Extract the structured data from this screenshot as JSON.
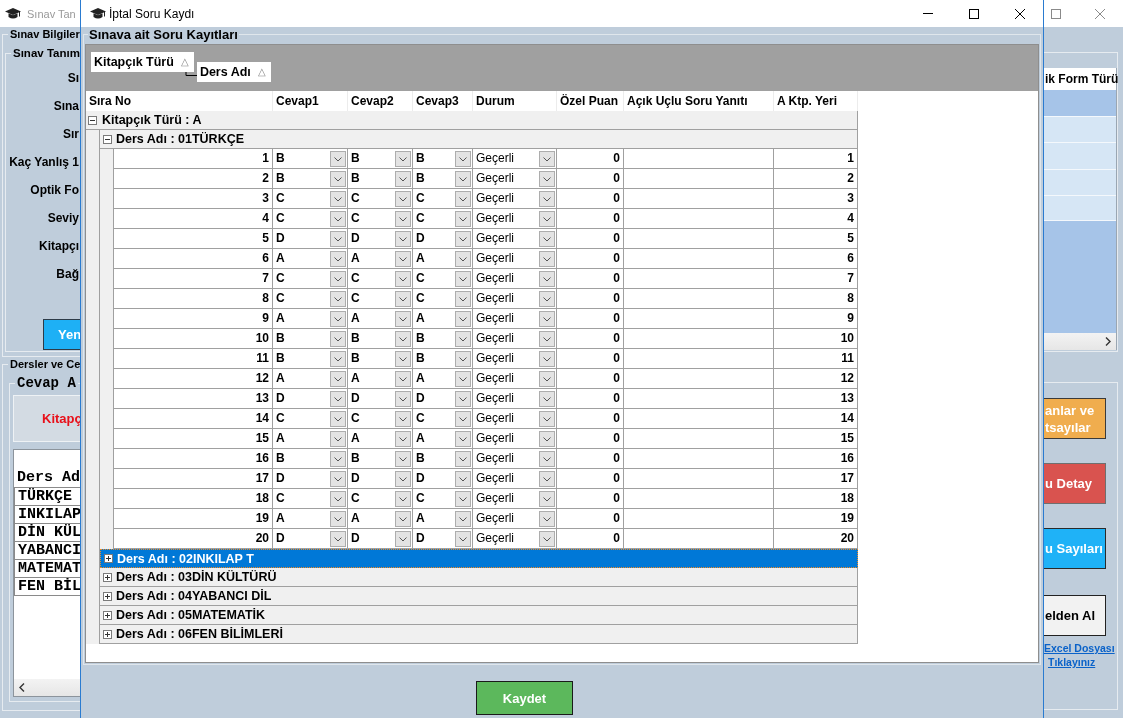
{
  "background_window": {
    "title": "Sınav Tan",
    "left_panel": {
      "info_group_title": "Sınav Bilgiler",
      "definition_group_title": "Sınav Tanım",
      "field_labels": [
        "Sı",
        "Sına",
        "Sır",
        "Kaç Yanlış 1",
        "Optik Fo",
        "Seviy",
        "Kitapçı",
        "Bağ"
      ],
      "new_button": "Yen",
      "lessons_group_title": "Dersler ve Ce",
      "answer_group_title": "Cevap A",
      "notice": "Kitapç",
      "list_header": "Ders Ad",
      "list_rows": [
        "TÜRKÇE",
        "INKILAP",
        "DİN KÜL",
        "YABANCI",
        "MATEMAT",
        "FEN BİL"
      ]
    },
    "right_panel": {
      "grid": {
        "column_header": "ik Form Türü",
        "rows": [
          {
            "selected": true
          },
          {
            "selected": false
          },
          {
            "selected": false
          },
          {
            "selected": false
          },
          {
            "selected": false
          }
        ]
      },
      "buttons": [
        {
          "label": "anlar ve\ntsayılar",
          "kind": "warning"
        },
        {
          "label": "u Detay",
          "kind": "danger"
        },
        {
          "label": "u Sayıları",
          "kind": "info"
        },
        {
          "label": "elden Al",
          "kind": "default"
        }
      ],
      "links": [
        "Excel Dosyası",
        "Tıklayınız"
      ]
    }
  },
  "dialog": {
    "title": "İptal Soru Kaydı",
    "group_title": "Sınava ait Soru Kayıtları",
    "group_by": [
      {
        "label": "Kitapçık Türü",
        "sort_glyph": "△"
      },
      {
        "label": "Ders Adı",
        "sort_glyph": "△"
      }
    ],
    "columns": [
      "Sıra No",
      "Cevap1",
      "Cevap2",
      "Cevap3",
      "Durum",
      "Özel Puan",
      "Açık Uçlu Soru Yanıtı",
      "A Ktp. Yeri"
    ],
    "groups": [
      {
        "label": "Kitapçık Türü : A",
        "expanded": true,
        "selected": false,
        "children": [
          {
            "label": "Ders Adı : 01TÜRKÇE",
            "expanded": true,
            "selected": false,
            "rows": [
              {
                "sira_no": "1",
                "cevap1": "B",
                "cevap2": "B",
                "cevap3": "B",
                "durum": "Geçerli",
                "ozel_puan": "0",
                "a_ktp_yeri": "1"
              },
              {
                "sira_no": "2",
                "cevap1": "B",
                "cevap2": "B",
                "cevap3": "B",
                "durum": "Geçerli",
                "ozel_puan": "0",
                "a_ktp_yeri": "2"
              },
              {
                "sira_no": "3",
                "cevap1": "C",
                "cevap2": "C",
                "cevap3": "C",
                "durum": "Geçerli",
                "ozel_puan": "0",
                "a_ktp_yeri": "3"
              },
              {
                "sira_no": "4",
                "cevap1": "C",
                "cevap2": "C",
                "cevap3": "C",
                "durum": "Geçerli",
                "ozel_puan": "0",
                "a_ktp_yeri": "4"
              },
              {
                "sira_no": "5",
                "cevap1": "D",
                "cevap2": "D",
                "cevap3": "D",
                "durum": "Geçerli",
                "ozel_puan": "0",
                "a_ktp_yeri": "5"
              },
              {
                "sira_no": "6",
                "cevap1": "A",
                "cevap2": "A",
                "cevap3": "A",
                "durum": "Geçerli",
                "ozel_puan": "0",
                "a_ktp_yeri": "6"
              },
              {
                "sira_no": "7",
                "cevap1": "C",
                "cevap2": "C",
                "cevap3": "C",
                "durum": "Geçerli",
                "ozel_puan": "0",
                "a_ktp_yeri": "7"
              },
              {
                "sira_no": "8",
                "cevap1": "C",
                "cevap2": "C",
                "cevap3": "C",
                "durum": "Geçerli",
                "ozel_puan": "0",
                "a_ktp_yeri": "8"
              },
              {
                "sira_no": "9",
                "cevap1": "A",
                "cevap2": "A",
                "cevap3": "A",
                "durum": "Geçerli",
                "ozel_puan": "0",
                "a_ktp_yeri": "9"
              },
              {
                "sira_no": "10",
                "cevap1": "B",
                "cevap2": "B",
                "cevap3": "B",
                "durum": "Geçerli",
                "ozel_puan": "0",
                "a_ktp_yeri": "10"
              },
              {
                "sira_no": "11",
                "cevap1": "B",
                "cevap2": "B",
                "cevap3": "B",
                "durum": "Geçerli",
                "ozel_puan": "0",
                "a_ktp_yeri": "11"
              },
              {
                "sira_no": "12",
                "cevap1": "A",
                "cevap2": "A",
                "cevap3": "A",
                "durum": "Geçerli",
                "ozel_puan": "0",
                "a_ktp_yeri": "12"
              },
              {
                "sira_no": "13",
                "cevap1": "D",
                "cevap2": "D",
                "cevap3": "D",
                "durum": "Geçerli",
                "ozel_puan": "0",
                "a_ktp_yeri": "13"
              },
              {
                "sira_no": "14",
                "cevap1": "C",
                "cevap2": "C",
                "cevap3": "C",
                "durum": "Geçerli",
                "ozel_puan": "0",
                "a_ktp_yeri": "14"
              },
              {
                "sira_no": "15",
                "cevap1": "A",
                "cevap2": "A",
                "cevap3": "A",
                "durum": "Geçerli",
                "ozel_puan": "0",
                "a_ktp_yeri": "15"
              },
              {
                "sira_no": "16",
                "cevap1": "B",
                "cevap2": "B",
                "cevap3": "B",
                "durum": "Geçerli",
                "ozel_puan": "0",
                "a_ktp_yeri": "16"
              },
              {
                "sira_no": "17",
                "cevap1": "D",
                "cevap2": "D",
                "cevap3": "D",
                "durum": "Geçerli",
                "ozel_puan": "0",
                "a_ktp_yeri": "17"
              },
              {
                "sira_no": "18",
                "cevap1": "C",
                "cevap2": "C",
                "cevap3": "C",
                "durum": "Geçerli",
                "ozel_puan": "0",
                "a_ktp_yeri": "18"
              },
              {
                "sira_no": "19",
                "cevap1": "A",
                "cevap2": "A",
                "cevap3": "A",
                "durum": "Geçerli",
                "ozel_puan": "0",
                "a_ktp_yeri": "19"
              },
              {
                "sira_no": "20",
                "cevap1": "D",
                "cevap2": "D",
                "cevap3": "D",
                "durum": "Geçerli",
                "ozel_puan": "0",
                "a_ktp_yeri": "20"
              }
            ]
          },
          {
            "label": "Ders Adı : 02INKILAP T",
            "expanded": false,
            "selected": true
          },
          {
            "label": "Ders Adı : 03DİN KÜLTÜRÜ",
            "expanded": false,
            "selected": false
          },
          {
            "label": "Ders Adı : 04YABANCI DİL",
            "expanded": false,
            "selected": false
          },
          {
            "label": "Ders Adı : 05MATEMATİK",
            "expanded": false,
            "selected": false
          },
          {
            "label": "Ders Adı : 06FEN BİLİMLERİ",
            "expanded": false,
            "selected": false
          }
        ]
      }
    ],
    "save_button": "Kaydet"
  }
}
